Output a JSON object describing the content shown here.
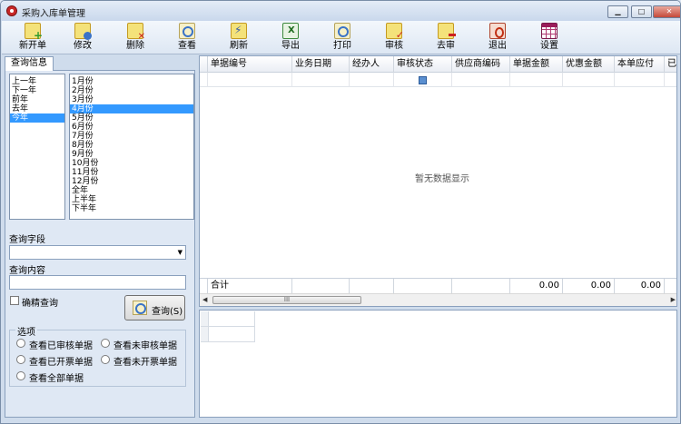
{
  "window": {
    "title": "采购入库单管理",
    "controls": {
      "minimize": "▁",
      "maximize": "□",
      "close": "✕"
    }
  },
  "toolbar": {
    "items": [
      {
        "label": "新开单",
        "icon": "new-document-icon"
      },
      {
        "label": "修改",
        "icon": "edit-icon"
      },
      {
        "label": "删除",
        "icon": "delete-icon"
      },
      {
        "label": "查看",
        "icon": "view-icon"
      },
      {
        "label": "刷新",
        "icon": "refresh-icon"
      },
      {
        "label": "导出",
        "icon": "excel-export-icon"
      },
      {
        "label": "打印",
        "icon": "print-icon"
      },
      {
        "label": "审核",
        "icon": "audit-icon"
      },
      {
        "label": "去审",
        "icon": "unaudit-icon"
      },
      {
        "label": "退出",
        "icon": "exit-icon"
      },
      {
        "label": "设置",
        "icon": "settings-grid-icon"
      }
    ]
  },
  "left_panel": {
    "tab_label": "查询信息",
    "years": [
      "上一年",
      "下一年",
      "前年",
      "去年",
      "今年"
    ],
    "selected_year": "今年",
    "months": [
      "1月份",
      "2月份",
      "3月份",
      "4月份",
      "5月份",
      "6月份",
      "7月份",
      "8月份",
      "9月份",
      "10月份",
      "11月份",
      "12月份",
      "全年",
      "上半年",
      "下半年"
    ],
    "selected_month": "4月份",
    "query_field_label": "查询字段",
    "query_field_value": "",
    "query_content_label": "查询内容",
    "query_content_value": "",
    "exact_query_label": "确精查询",
    "exact_query_checked": false,
    "query_button_label": "查询(S)",
    "options_title": "选项",
    "options": [
      "查看已审核单据",
      "查看未审核单据",
      "查看已开票单据",
      "查看未开票单据",
      "查看全部单据"
    ]
  },
  "grid": {
    "columns": [
      "单据编号",
      "业务日期",
      "经办人",
      "审核状态",
      "供应商编码",
      "单据金额",
      "优惠金额",
      "本单应付",
      "已"
    ],
    "empty_message": "暂无数据显示",
    "footer_label": "合计",
    "footer_totals": [
      "0.00",
      "0.00",
      "0.00"
    ],
    "scroll_thumb_label": "III"
  },
  "colors": {
    "selection": "#3399ff",
    "window_frame": "#cfdcec",
    "panel_bg": "#dfe8f4"
  }
}
